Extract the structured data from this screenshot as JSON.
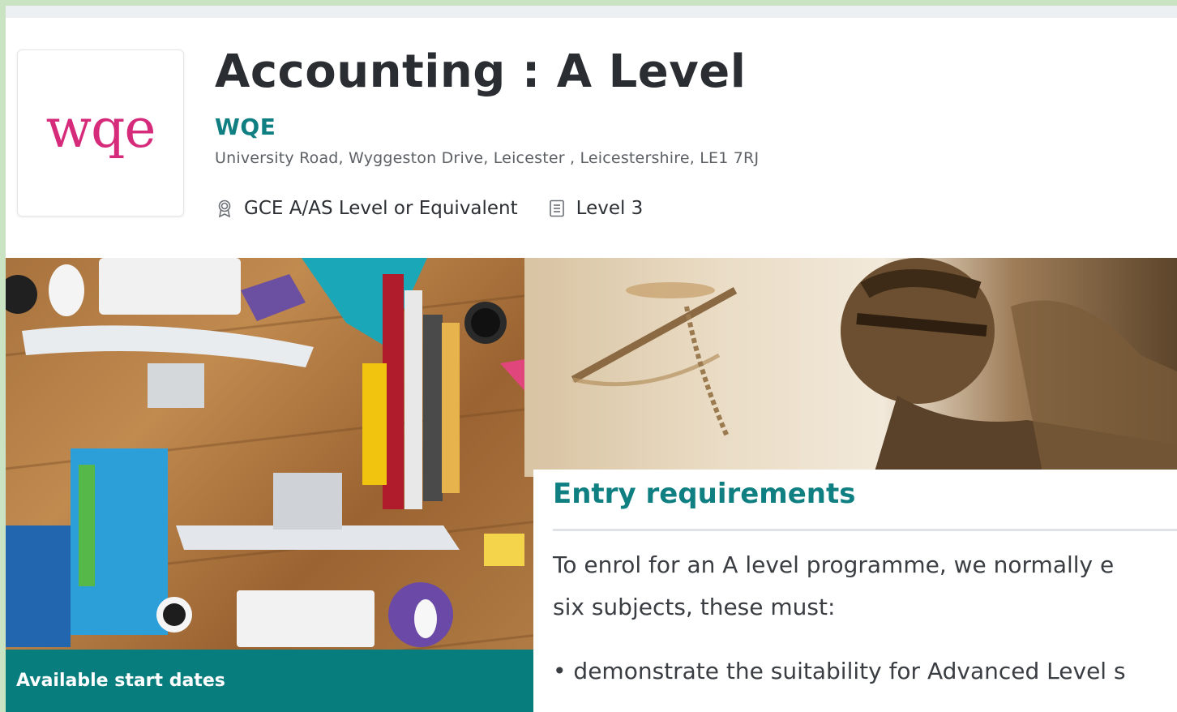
{
  "course": {
    "title": "Accounting : A Level",
    "provider": "WQE",
    "address": "University Road, Wyggeston Drive, Leicester , Leicestershire, LE1 7RJ",
    "qualification_type": "GCE A/AS Level or Equivalent",
    "level": "Level 3"
  },
  "logo": {
    "text": "wqe",
    "color": "#d62b7b"
  },
  "icons": {
    "qualification": "award-badge-icon",
    "level": "document-icon"
  },
  "start_dates": {
    "label": "Available start dates"
  },
  "entry_requirements": {
    "heading": "Entry requirements",
    "paragraph": "To enrol for an A level programme, we normally e\nsix subjects, these must:",
    "bullet_1": "• demonstrate the suitability for Advanced Level s"
  },
  "colors": {
    "accent_teal": "#0f7f82",
    "start_dates_bg": "#087d7d",
    "title_text": "#2a2d31",
    "frame_green": "#c9e3c3"
  }
}
